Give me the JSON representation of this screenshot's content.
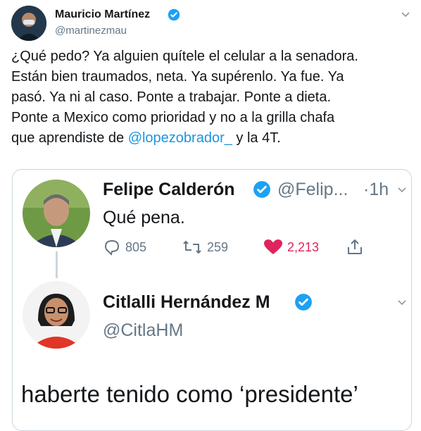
{
  "tweet": {
    "author_name": "Mauricio Martínez",
    "author_handle": "@martinezmau",
    "text_lines": [
      "¿Qué pedo? Ya alguien quítele el celular a la senadora.",
      "Están bien traumados, neta. Ya supérenlo. Ya fue. Ya",
      "pasó. Ya ni al caso. Ponte a trabajar. Ponte a dieta.",
      "Ponte a Mexico como prioridad y no a la grilla chafa"
    ],
    "last_line_prefix": "que aprendiste de ",
    "mention": "@lopezobrador_",
    "last_line_suffix": " y la 4T."
  },
  "embedded": {
    "first": {
      "name": "Felipe Calderón",
      "handle": "@Felip...",
      "time": "·1h",
      "text": "Qué pena.",
      "replies": "805",
      "retweets": "259",
      "likes": "2,213"
    },
    "second": {
      "name": "Citlalli Hernández M",
      "handle": "@CitlaHM",
      "text": "haberte tenido como ‘presidente’"
    }
  },
  "icons": {
    "verified_color": "#1da1f2",
    "like_color": "#e0245e"
  }
}
